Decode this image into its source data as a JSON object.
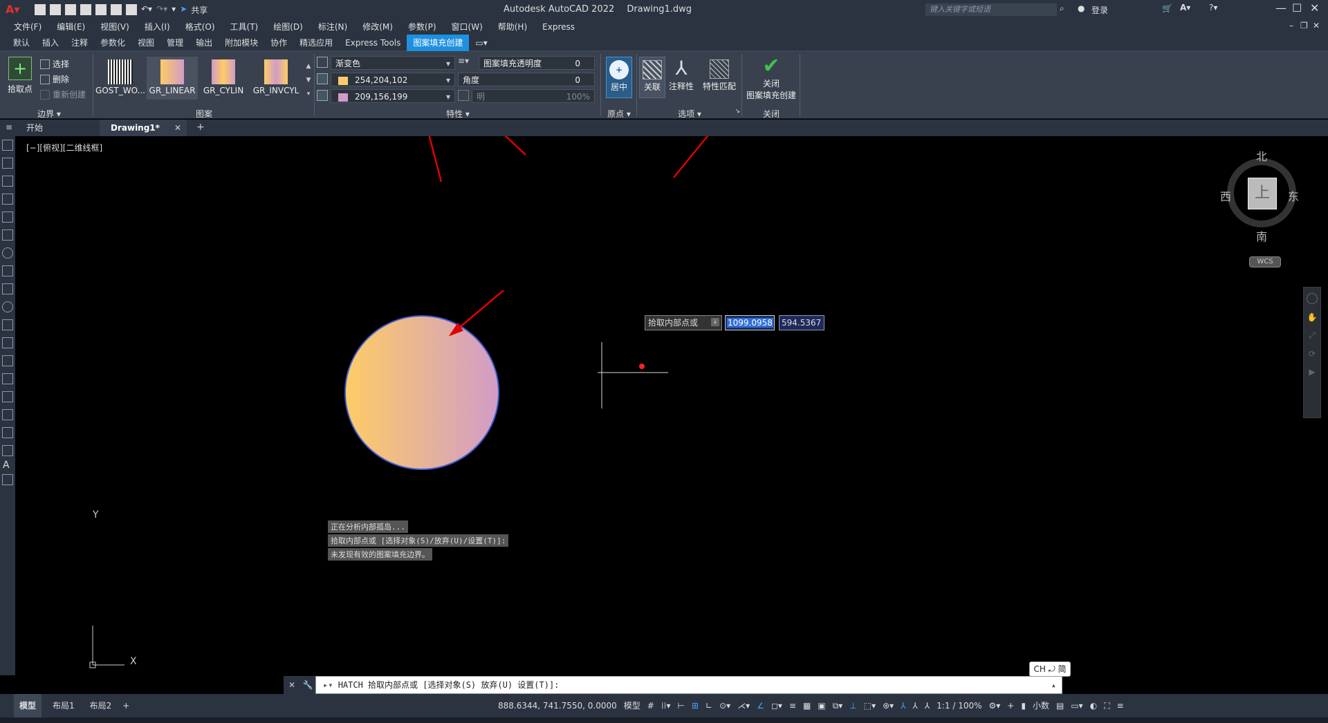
{
  "titlebar": {
    "app_title": "Autodesk AutoCAD 2022",
    "file_name": "Drawing1.dwg",
    "search_placeholder": "键入关键字或短语",
    "login_label": "登录",
    "share_label": "共享"
  },
  "menu": [
    "文件(F)",
    "编辑(E)",
    "视图(V)",
    "插入(I)",
    "格式(O)",
    "工具(T)",
    "绘图(D)",
    "标注(N)",
    "修改(M)",
    "参数(P)",
    "窗口(W)",
    "帮助(H)",
    "Express"
  ],
  "ribbon_tabs": [
    "默认",
    "插入",
    "注释",
    "参数化",
    "视图",
    "管理",
    "输出",
    "附加模块",
    "协作",
    "精选应用",
    "Express Tools",
    "图案填充创建"
  ],
  "ribbon_active_tab": "图案填充创建",
  "boundary_panel": {
    "title": "边界",
    "pick_label": "拾取点",
    "select_label": "选择",
    "remove_label": "删除",
    "recreate_label": "重新创建"
  },
  "pattern_panel": {
    "title": "图案",
    "patterns": [
      "GOST_WO...",
      "GR_LINEAR",
      "GR_CYLIN",
      "GR_INVCYL"
    ]
  },
  "properties_panel": {
    "title": "特性",
    "type_value": "渐变色",
    "color1_value": "254,204,102",
    "color2_value": "209,156,199",
    "transparency_label": "图案填充透明度",
    "transparency_value": "0",
    "angle_label": "角度",
    "angle_value": "0",
    "bright_label": "明",
    "bright_value": "100%"
  },
  "origin_panel": {
    "title": "原点",
    "center_label": "居中"
  },
  "options_panel": {
    "title": "选项",
    "assoc_label": "关联",
    "annotative_label": "注释性",
    "match_label": "特性匹配"
  },
  "close_panel": {
    "title": "关闭",
    "close_label_line1": "关闭",
    "close_label_line2": "图案填充创建"
  },
  "doc_tabs": {
    "start": "开始",
    "drawing": "Drawing1*"
  },
  "viewport_label": "[−][俯视][二维线框]",
  "viewcube": {
    "north": "北",
    "south": "南",
    "east": "东",
    "west": "西",
    "top": "上",
    "wcs": "WCS"
  },
  "cursor_prompt": {
    "label": "拾取内部点或",
    "x_value": "1099.0958",
    "y_value": "594.5367"
  },
  "ucs": {
    "x": "X",
    "y": "Y"
  },
  "command_history": [
    "正在分析内部孤岛...",
    "拾取内部点或 [选择对象(S)/放弃(U)/设置(T)]:",
    "未发现有效的图案填充边界。"
  ],
  "command_line": "HATCH 拾取内部点或 [选择对象(S) 放弃(U) 设置(T)]:",
  "ime": "CH ⤾ 简",
  "layout_tabs": [
    "模型",
    "布局1",
    "布局2"
  ],
  "status": {
    "coords": "888.6344, 741.7550, 0.0000",
    "model": "模型",
    "scale": "1:1 / 100%",
    "units": "小数"
  },
  "colors": {
    "accent": "#1e90e0",
    "gradient_start": "#fecc66",
    "gradient_end": "#d19cc7",
    "arrow": "#e00000"
  }
}
